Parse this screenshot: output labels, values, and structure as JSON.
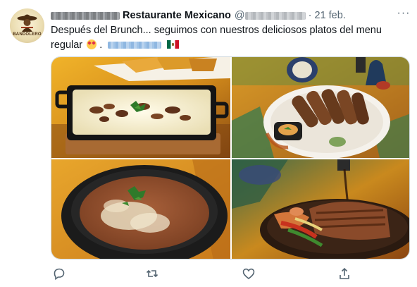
{
  "tweet": {
    "display_name": "Restaurante Mexicano",
    "handle_prefix": "@",
    "separator": "·",
    "date": "21 feb.",
    "more_glyph": "···",
    "avatar_text": "BANDOLERO",
    "text_line1": "Después del Brunch... seguimos con nuestros deliciosos platos del menu",
    "text_line2": "regular",
    "text_after_emoji": " .",
    "emoji_name": "star-struck-emoji",
    "flag_name": "mexico-flag"
  },
  "photos": [
    {
      "name": "queso-fundido-photo"
    },
    {
      "name": "flautas-plate-photo"
    },
    {
      "name": "refried-beans-bowl-photo"
    },
    {
      "name": "fajitas-skillet-photo"
    }
  ],
  "actions": [
    {
      "name": "reply-icon"
    },
    {
      "name": "retweet-icon"
    },
    {
      "name": "like-icon"
    },
    {
      "name": "share-icon"
    }
  ],
  "colors": {
    "text": "#0f1419",
    "secondary": "#536471",
    "link": "#1d9bf0",
    "border": "#cfd9de"
  }
}
